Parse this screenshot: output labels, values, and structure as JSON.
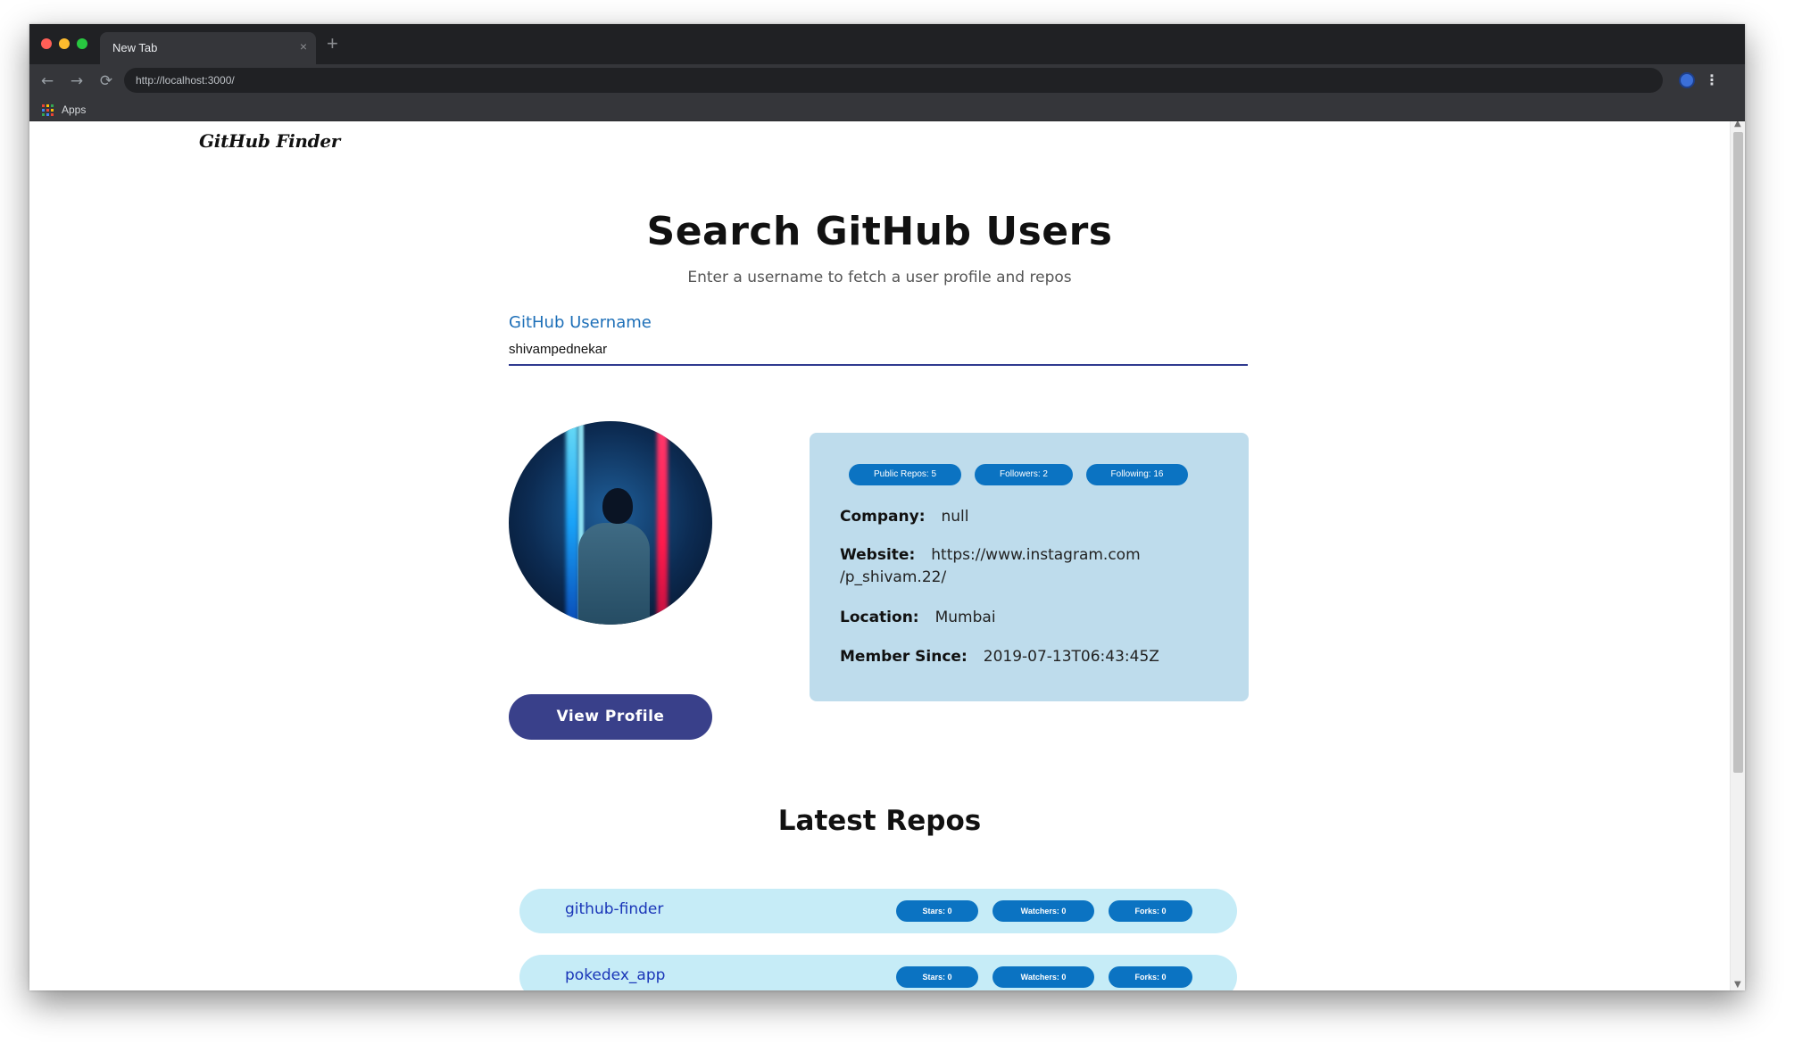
{
  "browser": {
    "tab_title": "New Tab",
    "tab_close": "×",
    "new_tab": "+",
    "url": "http://localhost:3000/",
    "bookmark_apps": "Apps"
  },
  "app": {
    "brand": "GitHub Finder",
    "title": "Search GitHub Users",
    "subtitle": "Enter a username to fetch a user profile and repos",
    "field_label": "GitHub Username",
    "username_value": "shivampednekar"
  },
  "profile": {
    "view_profile_label": "View Profile",
    "badges": {
      "public_repos": "Public Repos: 5",
      "followers": "Followers: 2",
      "following": "Following: 16"
    },
    "company_key": "Company:",
    "company_value": "null",
    "website_key": "Website:",
    "website_value_line1": "https://www.instagram.com",
    "website_value_line2": "/p_shivam.22/",
    "location_key": "Location:",
    "location_value": "Mumbai",
    "member_since_key": "Member Since:",
    "member_since_value": "2019-07-13T06:43:45Z"
  },
  "repos": {
    "title": "Latest Repos",
    "items": [
      {
        "name": "github-finder",
        "stars": "Stars: 0",
        "watchers": "Watchers: 0",
        "forks": "Forks: 0"
      },
      {
        "name": "pokedex_app",
        "stars": "Stars: 0",
        "watchers": "Watchers: 0",
        "forks": "Forks: 0"
      }
    ]
  },
  "colors": {
    "accent": "#39408a",
    "badge": "#0b73c2",
    "info_card": "#bedcec",
    "repo_card": "#c6ecf7",
    "link": "#1a36b8"
  },
  "icons": {
    "back": "arrow-left-icon",
    "forward": "arrow-right-icon",
    "reload": "reload-icon",
    "apps": "apps-grid-icon",
    "menu": "kebab-menu-icon"
  }
}
